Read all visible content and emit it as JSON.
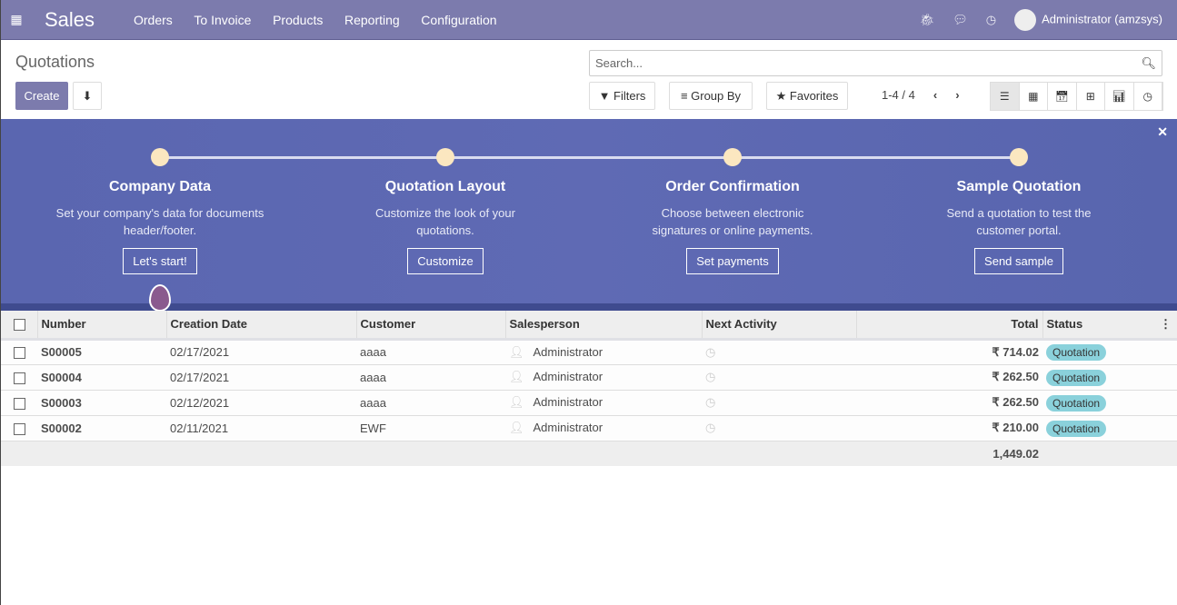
{
  "nav": {
    "app": "Sales",
    "menu": [
      "Orders",
      "To Invoice",
      "Products",
      "Reporting",
      "Configuration"
    ],
    "user": "Administrator (amzsys)"
  },
  "cp": {
    "title": "Quotations",
    "create": "Create",
    "search_placeholder": "Search...",
    "filters": "Filters",
    "group_by": "Group By",
    "favorites": "Favorites",
    "pager": "1-4 / 4"
  },
  "banner": {
    "steps": [
      {
        "title": "Company Data",
        "desc": "Set your company's data for documents header/footer.",
        "button": "Let's start!"
      },
      {
        "title": "Quotation Layout",
        "desc": "Customize the look of your quotations.",
        "button": "Customize"
      },
      {
        "title": "Order Confirmation",
        "desc": "Choose between electronic signatures or online payments.",
        "button": "Set payments"
      },
      {
        "title": "Sample Quotation",
        "desc": "Send a quotation to test the customer portal.",
        "button": "Send sample"
      }
    ]
  },
  "table": {
    "headers": [
      "Number",
      "Creation Date",
      "Customer",
      "Salesperson",
      "Next Activity",
      "Total",
      "Status"
    ],
    "rows": [
      {
        "number": "S00005",
        "date": "02/17/2021",
        "customer": "aaaa",
        "salesperson": "Administrator",
        "total": "₹ 714.02",
        "status": "Quotation"
      },
      {
        "number": "S00004",
        "date": "02/17/2021",
        "customer": "aaaa",
        "salesperson": "Administrator",
        "total": "₹ 262.50",
        "status": "Quotation"
      },
      {
        "number": "S00003",
        "date": "02/12/2021",
        "customer": "aaaa",
        "salesperson": "Administrator",
        "total": "₹ 262.50",
        "status": "Quotation"
      },
      {
        "number": "S00002",
        "date": "02/11/2021",
        "customer": "EWF",
        "salesperson": "Administrator",
        "total": "₹ 210.00",
        "status": "Quotation"
      }
    ],
    "sum": "1,449.02"
  }
}
